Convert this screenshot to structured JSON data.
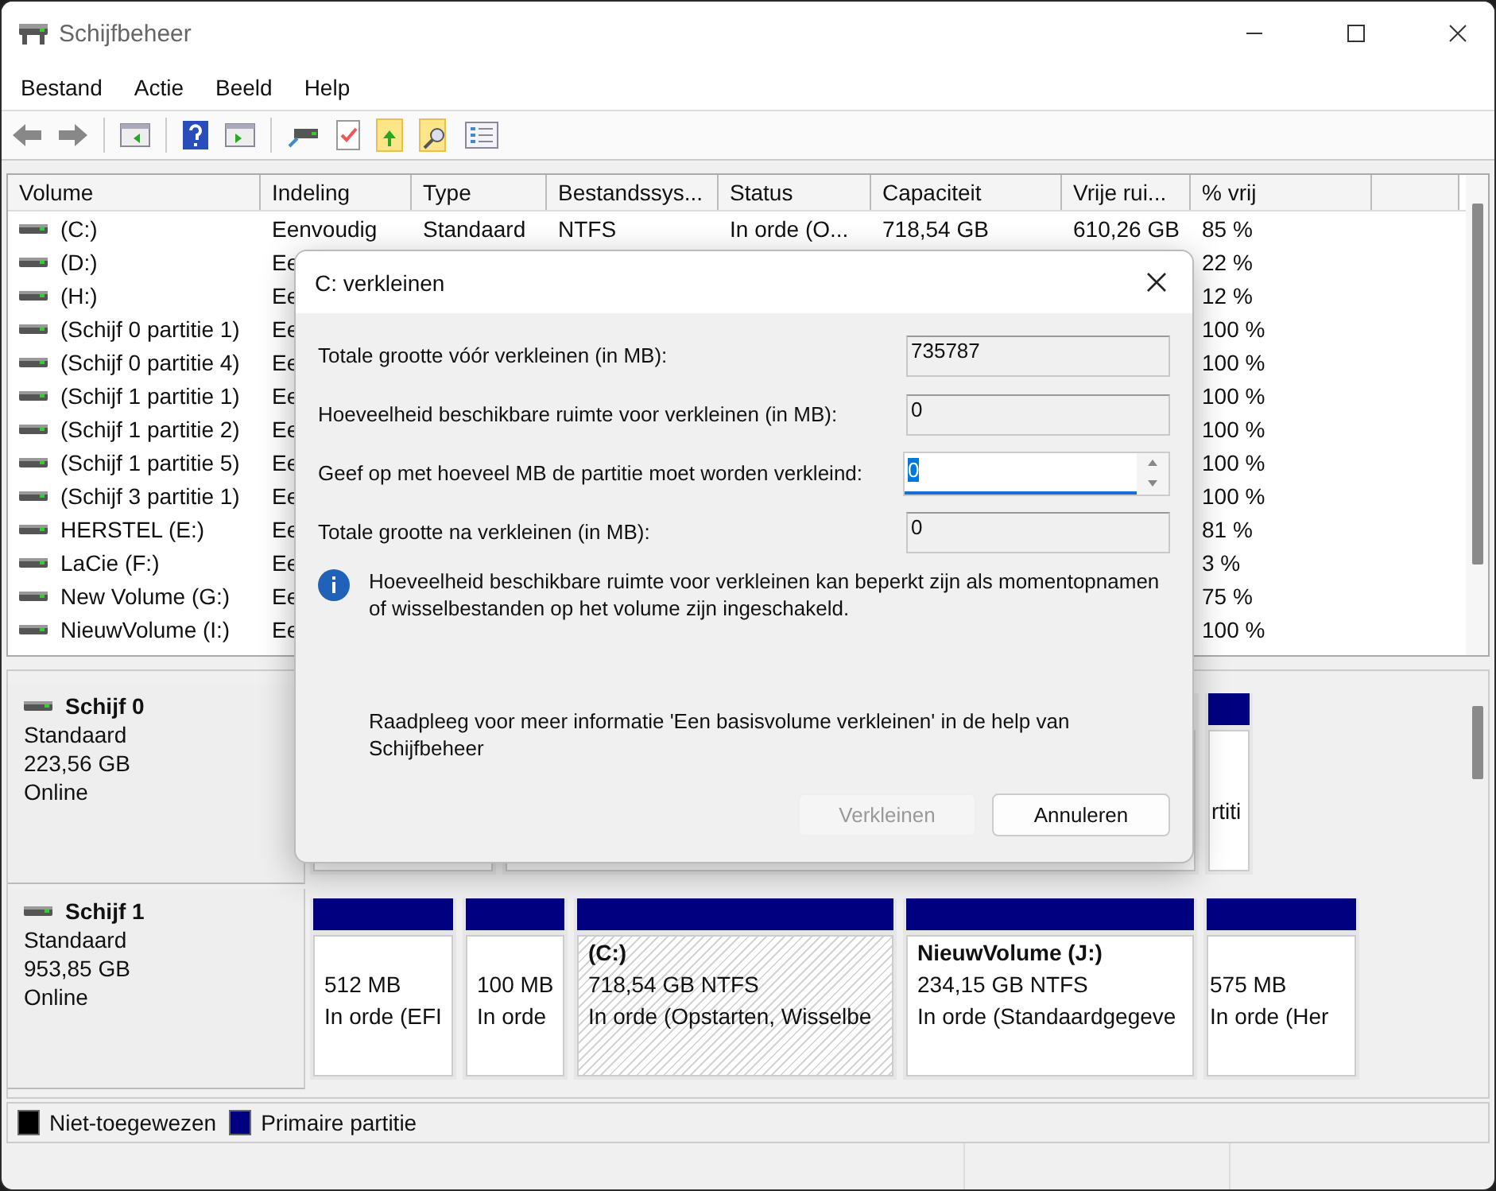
{
  "window": {
    "title": "Schijfbeheer"
  },
  "menu": [
    "Bestand",
    "Actie",
    "Beeld",
    "Help"
  ],
  "volumes": {
    "columns": [
      "Volume",
      "Indeling",
      "Type",
      "Bestandssys...",
      "Status",
      "Capaciteit",
      "Vrije rui...",
      "% vrij"
    ],
    "rows": [
      {
        "volume": "(C:)",
        "layout": "Eenvoudig",
        "type": "Standaard",
        "file_system": "NTFS",
        "status": "In orde (O...",
        "capacity": "718,54 GB",
        "free_space": "610,26 GB",
        "pct_free": "85 %"
      },
      {
        "volume": "(D:)",
        "layout": "Ee",
        "pct_free": "22 %"
      },
      {
        "volume": "(H:)",
        "layout": "Ee",
        "pct_free": "12 %"
      },
      {
        "volume": "(Schijf 0 partitie 1)",
        "layout": "Ee",
        "pct_free": "100 %"
      },
      {
        "volume": "(Schijf 0 partitie 4)",
        "layout": "Ee",
        "pct_free": "100 %"
      },
      {
        "volume": "(Schijf 1 partitie 1)",
        "layout": "Ee",
        "pct_free": "100 %"
      },
      {
        "volume": "(Schijf 1 partitie 2)",
        "layout": "Ee",
        "pct_free": "100 %"
      },
      {
        "volume": "(Schijf 1 partitie 5)",
        "layout": "Ee",
        "pct_free": "100 %"
      },
      {
        "volume": "(Schijf 3 partitie 1)",
        "layout": "Ee",
        "pct_free": "100 %"
      },
      {
        "volume": "HERSTEL (E:)",
        "layout": "Ee",
        "pct_free": "81 %"
      },
      {
        "volume": "LaCie (F:)",
        "layout": "Ee",
        "pct_free": "3 %"
      },
      {
        "volume": "New Volume (G:)",
        "layout": "Ee",
        "pct_free": "75 %"
      },
      {
        "volume": "NieuwVolume (I:)",
        "layout": "Ee",
        "pct_free": "100 %"
      }
    ]
  },
  "disks": [
    {
      "name": "Schijf 0",
      "type": "Standaard",
      "size": "223,56 GB",
      "status": "Online",
      "partitions": [
        {
          "selected": false
        },
        {
          "selected": false
        },
        {
          "selected": false,
          "status": "rtiti"
        }
      ]
    },
    {
      "name": "Schijf 1",
      "type": "Standaard",
      "size": "953,85 GB",
      "status": "Online",
      "partitions": [
        {
          "selected": false,
          "size": "512 MB",
          "status": "In orde (EFI"
        },
        {
          "selected": false,
          "size": "100 MB",
          "status": "In orde"
        },
        {
          "selected": true,
          "title": "(C:)",
          "size": "718,54 GB NTFS",
          "status": "In orde (Opstarten, Wisselbe"
        },
        {
          "selected": false,
          "title": "NieuwVolume  (J:)",
          "size": "234,15 GB NTFS",
          "status": "In orde (Standaardgegeve"
        },
        {
          "selected": false,
          "size": "575 MB",
          "status": "In orde (Her"
        }
      ]
    }
  ],
  "legend": [
    {
      "label": "Niet-toegewezen",
      "color": "#000000"
    },
    {
      "label": "Primaire partitie",
      "color": "#000080"
    }
  ],
  "dialog": {
    "title": "C: verkleinen",
    "fields": [
      {
        "label": "Totale grootte vóór verkleinen (in MB):",
        "value": "735787",
        "kind": "readonly"
      },
      {
        "label": "Hoeveelheid beschikbare ruimte voor verkleinen (in MB):",
        "value": "0",
        "kind": "readonly"
      },
      {
        "label": "Geef op met hoeveel MB de partitie moet worden verkleind:",
        "value": "0",
        "kind": "spinner"
      },
      {
        "label": "Totale grootte na verkleinen (in MB):",
        "value": "0",
        "kind": "readonly"
      }
    ],
    "info": "Hoeveelheid beschikbare ruimte voor verkleinen kan beperkt zijn als momentopnamen of wisselbestanden op het volume zijn ingeschakeld.",
    "help": "Raadpleeg voor meer informatie 'Een basisvolume verkleinen' in de help van Schijfbeheer",
    "buttons": [
      {
        "label": "Verkleinen",
        "disabled": true
      },
      {
        "label": "Annuleren",
        "disabled": false
      }
    ]
  }
}
